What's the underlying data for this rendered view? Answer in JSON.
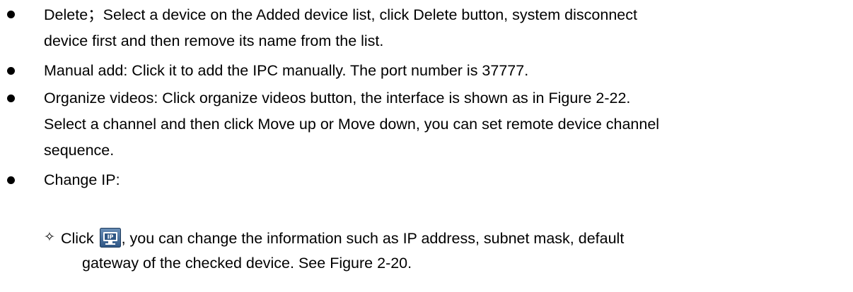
{
  "bullets": [
    {
      "lines": [
        "Delete；Select a device on the Added device list, click Delete button, system disconnect",
        "device first and then remove its name from the list."
      ]
    },
    {
      "lines": [
        "Manual add: Click it to add the IPC manually. The port number is 37777."
      ]
    },
    {
      "lines": [
        "Organize videos: Click organize videos button, the interface is shown as in Figure 2-22.",
        "Select a channel and then click Move up or Move down, you can set remote device channel",
        "sequence."
      ]
    },
    {
      "lines": [
        "Change IP:"
      ]
    }
  ],
  "sub_bullet": {
    "marker": "✧",
    "prefix": "Click",
    "icon": "change-ip-icon",
    "icon_label": "IP",
    "line1_suffix": ", you can change the information such as IP address, subnet mask, default",
    "line2": "gateway of the checked device. See Figure 2-20."
  }
}
